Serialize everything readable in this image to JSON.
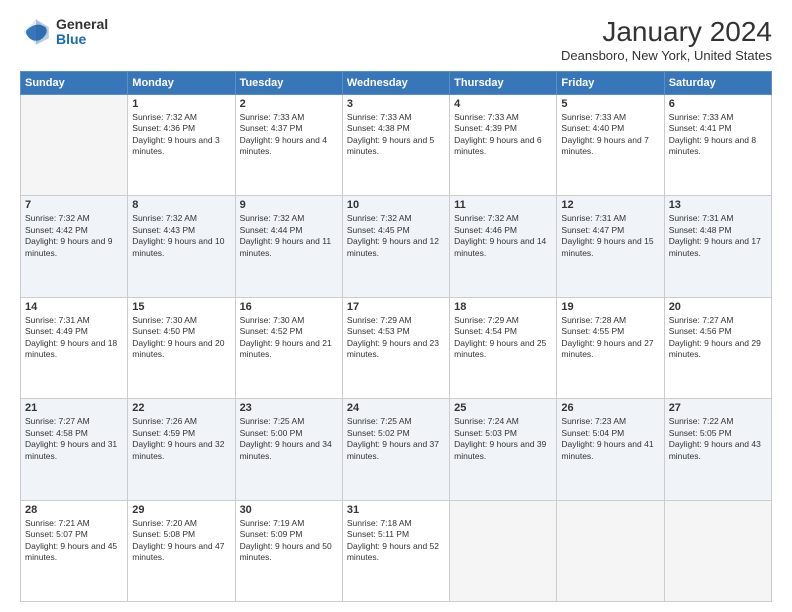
{
  "logo": {
    "general": "General",
    "blue": "Blue"
  },
  "title": "January 2024",
  "location": "Deansboro, New York, United States",
  "days": [
    "Sunday",
    "Monday",
    "Tuesday",
    "Wednesday",
    "Thursday",
    "Friday",
    "Saturday"
  ],
  "weeks": [
    [
      {
        "day": "",
        "sunrise": "",
        "sunset": "",
        "daylight": ""
      },
      {
        "day": "1",
        "sunrise": "Sunrise: 7:32 AM",
        "sunset": "Sunset: 4:36 PM",
        "daylight": "Daylight: 9 hours and 3 minutes."
      },
      {
        "day": "2",
        "sunrise": "Sunrise: 7:33 AM",
        "sunset": "Sunset: 4:37 PM",
        "daylight": "Daylight: 9 hours and 4 minutes."
      },
      {
        "day": "3",
        "sunrise": "Sunrise: 7:33 AM",
        "sunset": "Sunset: 4:38 PM",
        "daylight": "Daylight: 9 hours and 5 minutes."
      },
      {
        "day": "4",
        "sunrise": "Sunrise: 7:33 AM",
        "sunset": "Sunset: 4:39 PM",
        "daylight": "Daylight: 9 hours and 6 minutes."
      },
      {
        "day": "5",
        "sunrise": "Sunrise: 7:33 AM",
        "sunset": "Sunset: 4:40 PM",
        "daylight": "Daylight: 9 hours and 7 minutes."
      },
      {
        "day": "6",
        "sunrise": "Sunrise: 7:33 AM",
        "sunset": "Sunset: 4:41 PM",
        "daylight": "Daylight: 9 hours and 8 minutes."
      }
    ],
    [
      {
        "day": "7",
        "sunrise": "Sunrise: 7:32 AM",
        "sunset": "Sunset: 4:42 PM",
        "daylight": "Daylight: 9 hours and 9 minutes."
      },
      {
        "day": "8",
        "sunrise": "Sunrise: 7:32 AM",
        "sunset": "Sunset: 4:43 PM",
        "daylight": "Daylight: 9 hours and 10 minutes."
      },
      {
        "day": "9",
        "sunrise": "Sunrise: 7:32 AM",
        "sunset": "Sunset: 4:44 PM",
        "daylight": "Daylight: 9 hours and 11 minutes."
      },
      {
        "day": "10",
        "sunrise": "Sunrise: 7:32 AM",
        "sunset": "Sunset: 4:45 PM",
        "daylight": "Daylight: 9 hours and 12 minutes."
      },
      {
        "day": "11",
        "sunrise": "Sunrise: 7:32 AM",
        "sunset": "Sunset: 4:46 PM",
        "daylight": "Daylight: 9 hours and 14 minutes."
      },
      {
        "day": "12",
        "sunrise": "Sunrise: 7:31 AM",
        "sunset": "Sunset: 4:47 PM",
        "daylight": "Daylight: 9 hours and 15 minutes."
      },
      {
        "day": "13",
        "sunrise": "Sunrise: 7:31 AM",
        "sunset": "Sunset: 4:48 PM",
        "daylight": "Daylight: 9 hours and 17 minutes."
      }
    ],
    [
      {
        "day": "14",
        "sunrise": "Sunrise: 7:31 AM",
        "sunset": "Sunset: 4:49 PM",
        "daylight": "Daylight: 9 hours and 18 minutes."
      },
      {
        "day": "15",
        "sunrise": "Sunrise: 7:30 AM",
        "sunset": "Sunset: 4:50 PM",
        "daylight": "Daylight: 9 hours and 20 minutes."
      },
      {
        "day": "16",
        "sunrise": "Sunrise: 7:30 AM",
        "sunset": "Sunset: 4:52 PM",
        "daylight": "Daylight: 9 hours and 21 minutes."
      },
      {
        "day": "17",
        "sunrise": "Sunrise: 7:29 AM",
        "sunset": "Sunset: 4:53 PM",
        "daylight": "Daylight: 9 hours and 23 minutes."
      },
      {
        "day": "18",
        "sunrise": "Sunrise: 7:29 AM",
        "sunset": "Sunset: 4:54 PM",
        "daylight": "Daylight: 9 hours and 25 minutes."
      },
      {
        "day": "19",
        "sunrise": "Sunrise: 7:28 AM",
        "sunset": "Sunset: 4:55 PM",
        "daylight": "Daylight: 9 hours and 27 minutes."
      },
      {
        "day": "20",
        "sunrise": "Sunrise: 7:27 AM",
        "sunset": "Sunset: 4:56 PM",
        "daylight": "Daylight: 9 hours and 29 minutes."
      }
    ],
    [
      {
        "day": "21",
        "sunrise": "Sunrise: 7:27 AM",
        "sunset": "Sunset: 4:58 PM",
        "daylight": "Daylight: 9 hours and 31 minutes."
      },
      {
        "day": "22",
        "sunrise": "Sunrise: 7:26 AM",
        "sunset": "Sunset: 4:59 PM",
        "daylight": "Daylight: 9 hours and 32 minutes."
      },
      {
        "day": "23",
        "sunrise": "Sunrise: 7:25 AM",
        "sunset": "Sunset: 5:00 PM",
        "daylight": "Daylight: 9 hours and 34 minutes."
      },
      {
        "day": "24",
        "sunrise": "Sunrise: 7:25 AM",
        "sunset": "Sunset: 5:02 PM",
        "daylight": "Daylight: 9 hours and 37 minutes."
      },
      {
        "day": "25",
        "sunrise": "Sunrise: 7:24 AM",
        "sunset": "Sunset: 5:03 PM",
        "daylight": "Daylight: 9 hours and 39 minutes."
      },
      {
        "day": "26",
        "sunrise": "Sunrise: 7:23 AM",
        "sunset": "Sunset: 5:04 PM",
        "daylight": "Daylight: 9 hours and 41 minutes."
      },
      {
        "day": "27",
        "sunrise": "Sunrise: 7:22 AM",
        "sunset": "Sunset: 5:05 PM",
        "daylight": "Daylight: 9 hours and 43 minutes."
      }
    ],
    [
      {
        "day": "28",
        "sunrise": "Sunrise: 7:21 AM",
        "sunset": "Sunset: 5:07 PM",
        "daylight": "Daylight: 9 hours and 45 minutes."
      },
      {
        "day": "29",
        "sunrise": "Sunrise: 7:20 AM",
        "sunset": "Sunset: 5:08 PM",
        "daylight": "Daylight: 9 hours and 47 minutes."
      },
      {
        "day": "30",
        "sunrise": "Sunrise: 7:19 AM",
        "sunset": "Sunset: 5:09 PM",
        "daylight": "Daylight: 9 hours and 50 minutes."
      },
      {
        "day": "31",
        "sunrise": "Sunrise: 7:18 AM",
        "sunset": "Sunset: 5:11 PM",
        "daylight": "Daylight: 9 hours and 52 minutes."
      },
      {
        "day": "",
        "sunrise": "",
        "sunset": "",
        "daylight": ""
      },
      {
        "day": "",
        "sunrise": "",
        "sunset": "",
        "daylight": ""
      },
      {
        "day": "",
        "sunrise": "",
        "sunset": "",
        "daylight": ""
      }
    ]
  ]
}
